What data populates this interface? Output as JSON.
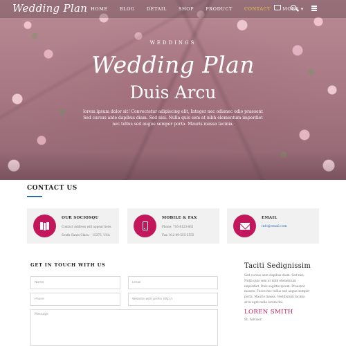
{
  "nav": {
    "logo": "Wedding Plan",
    "items": [
      {
        "label": "HOME",
        "active": false
      },
      {
        "label": "BLOG",
        "active": false
      },
      {
        "label": "DETAIL",
        "active": false
      },
      {
        "label": "SHOP",
        "active": false
      },
      {
        "label": "PRODUCT",
        "active": false
      },
      {
        "label": "CONTACT",
        "active": true
      },
      {
        "label": "MORE ▾",
        "active": false
      }
    ],
    "icons": [
      "cart-icon",
      "search-icon",
      "menu-icon"
    ]
  },
  "hero": {
    "eyebrow": "WEDDINGS",
    "title": "Wedding Plan",
    "subtitle": "Duis Arcu",
    "description": "lorem ipsum dolor sit! Convectetur adipiscing elit, Integer nec odionec odio praesent Sed cursus ante dapibus diam. Sed nisi. Nulla quis sem at nibh elementum imperdiet nec tellus sed augue semper porta. Mauris massa lacinia."
  },
  "contact": {
    "title": "CONTACT US",
    "cards": [
      {
        "icon": "map-icon",
        "title": "OUR SOCIOSQU",
        "line1": "Contact Address will appear here.",
        "line2": "South Santa Clara, - 15375, USA"
      },
      {
        "icon": "phone-icon",
        "title": "MOBILE & FAX",
        "line1": "Phone: 716-8123-862",
        "line2": "Fax: 012-49-555-5555"
      },
      {
        "icon": "mail-icon",
        "title": "EMAIL",
        "link": "info@email.com"
      }
    ]
  },
  "form": {
    "title": "GET IN TOUCH WITH US",
    "name_placeholder": "Name",
    "email_placeholder": "Email",
    "phone_placeholder": "Phone",
    "website_placeholder": "Website with prefix http://",
    "message_placeholder": "Message"
  },
  "sidebar": {
    "title": "Taciti Sedignissim",
    "text": "Sed cursus ante dapibus diam. Sed nisi. Nulla quis sem at nibh elementum imperdiet. Duis sagittis ipsum. Praesent mauris. Fusce nec tellus sed augue semper porta. Mauris massa. Vestibulum lacinia arcu eget nulla lorem dui.",
    "name": "LOREN SMITH",
    "role": "St. Advisor"
  },
  "colors": {
    "accent": "#c2185b",
    "link": "#2a6cb3",
    "nav_active": "#f2c94c"
  }
}
